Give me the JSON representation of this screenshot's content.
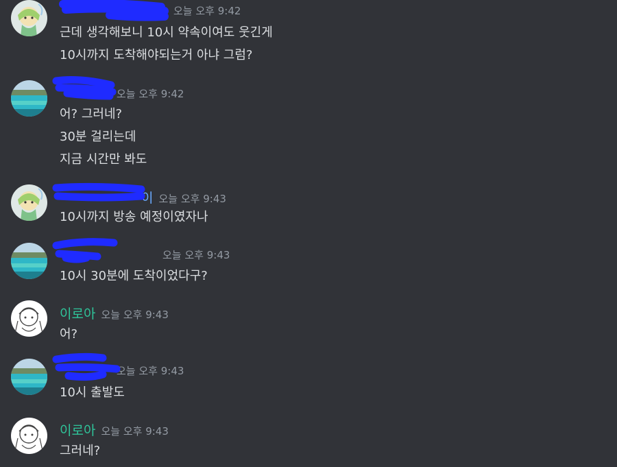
{
  "colors": {
    "background": "#313338",
    "text": "#dbdee1",
    "timestamp": "#949ba4",
    "author_green": "#2fc49a",
    "author_blue": "#6aa9ff",
    "redaction": "#1f2bff"
  },
  "messages": [
    {
      "author": "",
      "author_suffix": "",
      "avatar": "anime-girl-avatar",
      "timestamp": "오늘 오후 9:42",
      "lines": [
        "근데 생각해보니 10시 약속이여도 웃긴게",
        "10시까지 도착해야되는거 아냐 그럼?"
      ]
    },
    {
      "author": "",
      "author_suffix": "",
      "avatar": "beach-avatar",
      "timestamp": "오늘 오후 9:42",
      "lines": [
        "어? 그러네?",
        "30분 걸리는데",
        "지금 시간만 봐도"
      ]
    },
    {
      "author": "",
      "author_suffix": "이",
      "avatar": "anime-girl-avatar",
      "timestamp": "오늘 오후 9:43",
      "lines": [
        "10시까지 방송 예정이였자나"
      ]
    },
    {
      "author": "",
      "author_suffix": "",
      "avatar": "beach-avatar",
      "timestamp": "오늘 오후 9:43",
      "lines": [
        "10시 30분에 도착이었다구?"
      ]
    },
    {
      "author": "이로아",
      "author_suffix": "",
      "avatar": "sketch-avatar",
      "timestamp": "오늘 오후 9:43",
      "lines": [
        "어?"
      ]
    },
    {
      "author": "",
      "author_suffix": "",
      "avatar": "beach-avatar",
      "timestamp": "오늘 오후 9:43",
      "lines": [
        "10시 출발도"
      ]
    },
    {
      "author": "이로아",
      "author_suffix": "",
      "avatar": "sketch-avatar",
      "timestamp": "오늘 오후 9:43",
      "lines": [
        "그러네?"
      ]
    }
  ]
}
